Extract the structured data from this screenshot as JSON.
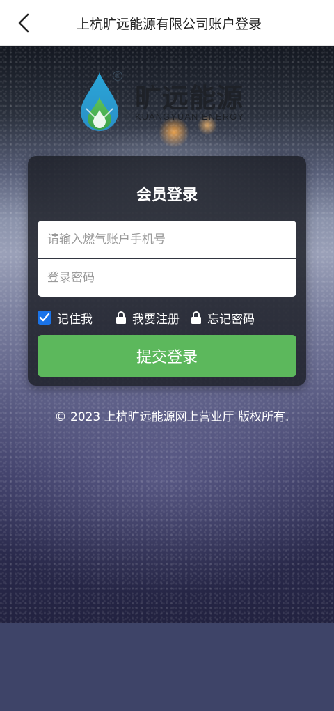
{
  "header": {
    "title": "上杭旷远能源有限公司账户登录",
    "back_icon": "chevron-left-icon"
  },
  "logo": {
    "name_cn": "旷远能源",
    "name_en": "KUANGYUAN ENERGY",
    "registered_mark": "®"
  },
  "login_card": {
    "title": "会员登录",
    "phone_placeholder": "请输入燃气账户手机号",
    "password_placeholder": "登录密码",
    "remember_label": "记住我",
    "remember_checked": true,
    "register_label": "我要注册",
    "forgot_label": "忘记密码",
    "submit_label": "提交登录"
  },
  "footer": {
    "copyright": "© 2023 上杭旷远能源网上营业厅 版权所有."
  },
  "colors": {
    "submit_button": "#5cb85c",
    "checkbox": "#1a73e8",
    "bottom_band": "#3e4468"
  }
}
